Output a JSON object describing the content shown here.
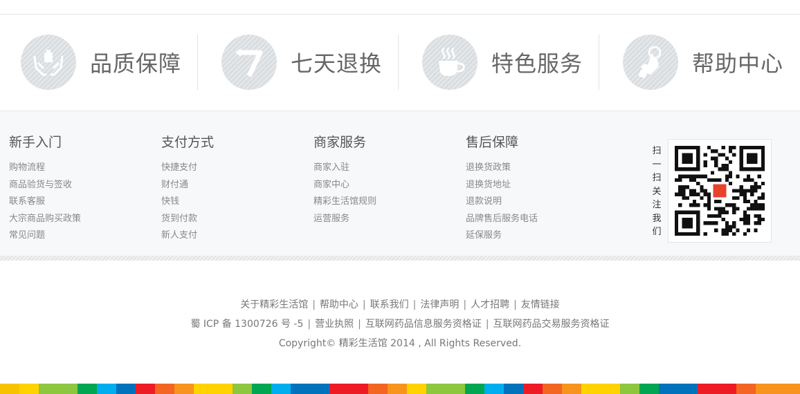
{
  "services": [
    {
      "label": "品质保障",
      "icon": "hands-box-icon"
    },
    {
      "label": "七天退换",
      "icon": "seven-return-icon"
    },
    {
      "label": "特色服务",
      "icon": "coffee-cup-icon"
    },
    {
      "label": "帮助中心",
      "icon": "pointing-hand-icon"
    }
  ],
  "columns": [
    {
      "title": "新手入门",
      "items": [
        "购物流程",
        "商品验货与签收",
        "联系客服",
        "大宗商品购买政策",
        "常见问题"
      ]
    },
    {
      "title": "支付方式",
      "items": [
        "快捷支付",
        "财付通",
        "快钱",
        "货到付款",
        "新人支付"
      ]
    },
    {
      "title": "商家服务",
      "items": [
        "商家入驻",
        "商家中心",
        "精彩生活馆规则",
        "运营服务"
      ]
    },
    {
      "title": "售后保障",
      "items": [
        "退换货政策",
        "退换货地址",
        "退款说明",
        "品牌售后服务电话",
        "延保服务"
      ]
    }
  ],
  "qr": {
    "caption_chars": [
      "扫",
      "一",
      "扫",
      "关",
      "注",
      "我",
      "们"
    ]
  },
  "bottom": {
    "links": [
      "关于精彩生活馆",
      "帮助中心",
      "联系我们",
      "法律声明",
      "人才招聘",
      "友情链接"
    ],
    "licenses": [
      "蜀 ICP 备 1300726 号 -5",
      "营业执照",
      "互联网药品信息服务资格证",
      "互联网药品交易服务资格证"
    ],
    "copyright": "Copyright© 精彩生活馆 2014 , All Rights Reserved.",
    "separator": "|"
  },
  "colors": {
    "colorbar": [
      "#f7c300",
      "#ffd200",
      "#8dc63f",
      "#8dc63f",
      "#00a651",
      "#00aeef",
      "#0072bc",
      "#ed1c24",
      "#f26522",
      "#f7941d",
      "#ffd200",
      "#ffd200",
      "#8dc63f",
      "#00a651",
      "#00aeef",
      "#0072bc",
      "#0072bc",
      "#ed1c24",
      "#ed1c24",
      "#f26522",
      "#f7941d",
      "#ffd200",
      "#8dc63f",
      "#8dc63f",
      "#00a651",
      "#00aeef",
      "#0072bc",
      "#ed1c24",
      "#f26522",
      "#f7941d",
      "#ffd200",
      "#ffd200",
      "#8dc63f",
      "#00a651",
      "#0072bc",
      "#0072bc",
      "#ed1c24",
      "#ed1c24",
      "#f26522",
      "#f7941d"
    ]
  }
}
